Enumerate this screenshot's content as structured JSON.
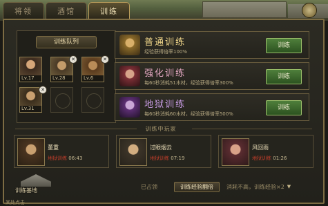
{
  "tabs": [
    "将领",
    "酒馆",
    "训练"
  ],
  "team_title": "训练队列",
  "slots": [
    {
      "level": "Lv.17"
    },
    {
      "level": "Lv.28"
    },
    {
      "level": "Lv.6"
    },
    {
      "level": "Lv.31"
    }
  ],
  "options": [
    {
      "name": "普通训练",
      "desc": "经验获得倍率100%",
      "button": "训练",
      "name_color": "#f0d68a",
      "icon_color": "#8a6a2a"
    },
    {
      "name": "强化训练",
      "desc": "每60秒消耗51木材，经验获得倍率300%",
      "button": "训练",
      "name_color": "#e2a6c0",
      "icon_color": "#7c2f36"
    },
    {
      "name": "地狱训练",
      "desc": "每60秒消耗60木材，经验获得倍率500%",
      "button": "训练",
      "name_color": "#c79be3",
      "icon_color": "#5d2f74"
    }
  ],
  "section_title": "训练中玩家",
  "players": [
    {
      "name": "董重",
      "mode": "地狱训练",
      "time": "06:43",
      "level": "Lv.34"
    },
    {
      "name": "过眼烟云",
      "mode": "地狱训练",
      "time": "07:19",
      "level": ""
    },
    {
      "name": "风回雨",
      "mode": "地狱训练",
      "time": "01:26",
      "level": ""
    }
  ],
  "base_label": "训练基地",
  "bottom": {
    "left": "已占领",
    "middle": "训练经验翻倍",
    "right": "消耗不高，训练经验×2"
  },
  "footer": "某处点击",
  "colors": {
    "accent": "#b99c5a",
    "button_green": "#2c5220",
    "red_text": "#bf3d2a"
  }
}
